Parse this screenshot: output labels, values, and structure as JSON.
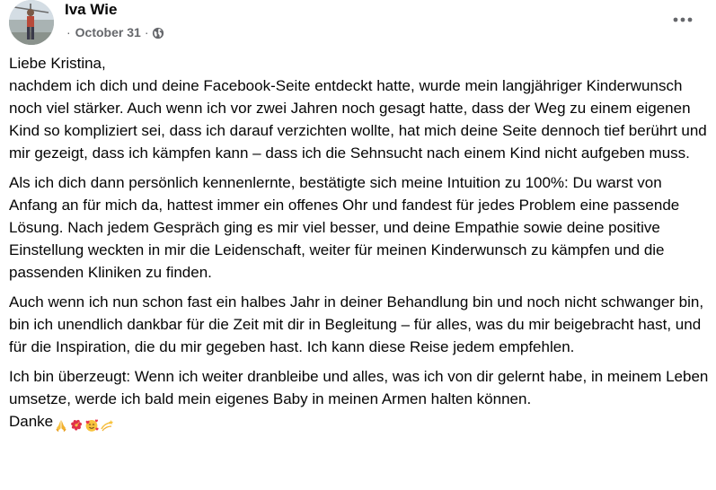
{
  "post": {
    "author": "Iva Wie",
    "date": "October 31",
    "separator": "·",
    "privacy_icon": "globe-icon",
    "more_icon": "more-options-icon",
    "paragraphs": [
      "Liebe Kristina,\nnachdem ich dich und deine Facebook-Seite entdeckt hatte, wurde mein langjähriger Kinderwunsch noch viel stärker. Auch wenn ich vor zwei Jahren noch gesagt hatte, dass der Weg zu einem eigenen Kind so kompliziert sei, dass ich darauf verzichten wollte, hat mich deine Seite dennoch tief berührt und mir gezeigt, dass ich kämpfen kann – dass ich die Sehnsucht nach einem Kind nicht aufgeben muss.",
      "Als ich dich dann persönlich kennenlernte, bestätigte sich meine Intuition zu 100%: Du warst von Anfang an für mich da, hattest immer ein offenes Ohr und fandest für jedes Problem eine passende Lösung. Nach jedem Gespräch ging es mir viel besser, und deine Empathie sowie deine positive Einstellung weckten in mir die Leidenschaft, weiter für meinen Kinderwunsch zu kämpfen und die passenden Kliniken zu finden.",
      "Auch wenn ich nun schon fast ein halbes Jahr in deiner Behandlung bin und noch nicht schwanger bin, bin ich unendlich dankbar für die Zeit mit dir in Begleitung – für alles, was du mir beigebracht hast, und für die Inspiration, die du mir gegeben hast. Ich kann diese Reise jedem empfehlen.",
      "Ich bin überzeugt: Wenn ich weiter dranbleibe und alles, was ich von dir gelernt habe, in meinem Leben umsetze, werde ich bald mein eigenes Baby in meinen Armen halten können."
    ],
    "closing": "Danke",
    "closing_emojis": [
      "praying-hands-icon",
      "hibiscus-icon",
      "smiling-face-with-hearts-icon",
      "dizzy-icon"
    ]
  }
}
